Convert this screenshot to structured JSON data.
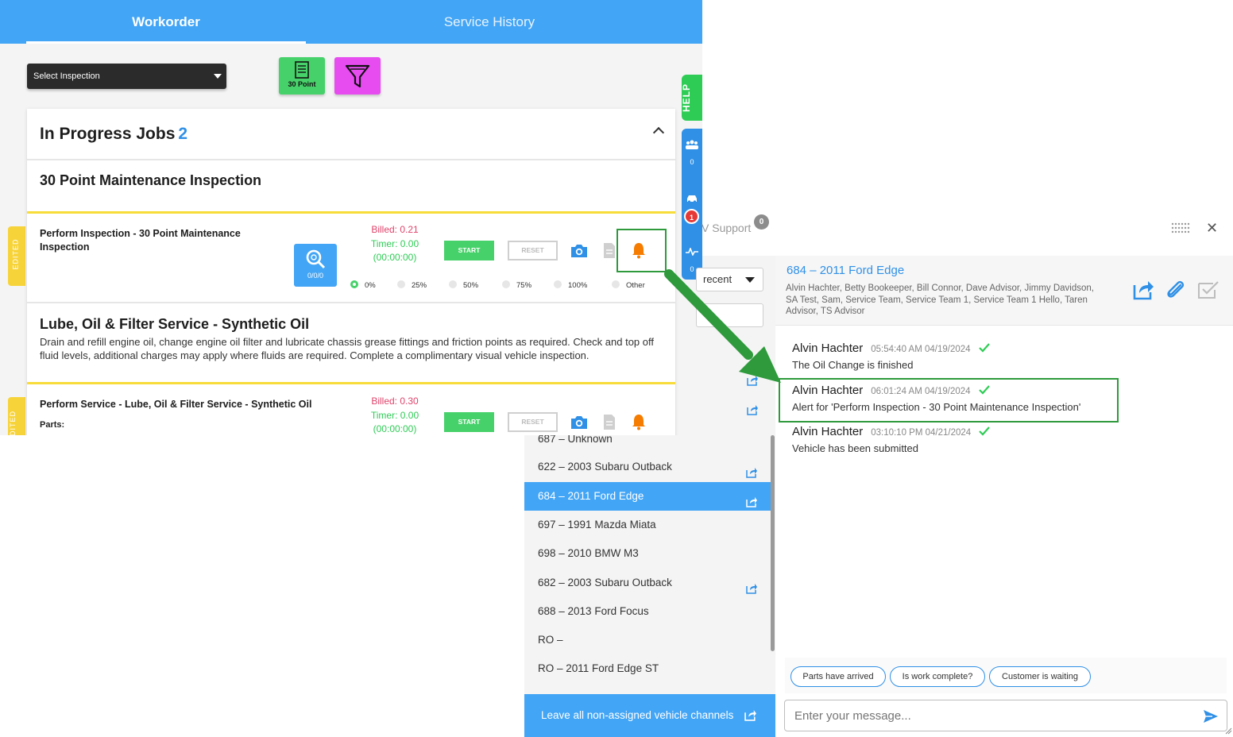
{
  "workorder": {
    "tabs": [
      {
        "label": "Workorder"
      },
      {
        "label": "Service History"
      }
    ],
    "select_inspection": "Select Inspection",
    "btn_30point": "30 Point",
    "help": "HELP",
    "rail_counts": [
      "0",
      "0"
    ],
    "rail_badge": "1",
    "in_progress": {
      "title": "In Progress Jobs",
      "count": "2"
    },
    "section1": {
      "title": "30 Point Maintenance Inspection",
      "task": {
        "title": "Perform Inspection - 30 Point Maintenance Inspection",
        "billed": "Billed: 0.21",
        "timer": "Timer: 0.00",
        "elapsed": "(00:00:00)",
        "start": "START",
        "reset": "RESET",
        "inspect_count": "0/0/0",
        "progress_options": [
          "0%",
          "25%",
          "50%",
          "75%",
          "100%",
          "Other"
        ],
        "progress_selected": "0%"
      }
    },
    "section2": {
      "title": "Lube, Oil & Filter Service - Synthetic Oil",
      "description": "Drain and refill engine oil, change engine oil filter and lubricate chassis grease fittings and friction points as required. Check and top off fluid levels, additional charges may apply where fluids are required. Complete a complimentary visual vehicle inspection.",
      "task": {
        "title": "Perform Service - Lube, Oil & Filter Service - Synthetic Oil",
        "parts": "Parts:",
        "billed": "Billed: 0.30",
        "timer": "Timer: 0.00",
        "elapsed": "(00:00:00)",
        "start": "START",
        "reset": "RESET"
      }
    },
    "edited_label": "EDITED",
    "edited_label_cut": "DITED"
  },
  "chat": {
    "channel_title": "V Support",
    "channel_badge": "0",
    "sort": "recent",
    "vehicles": [
      {
        "label": "687 – Unknown",
        "share": false,
        "active": false
      },
      {
        "label": "622 – 2003 Subaru Outback",
        "share": true,
        "active": false
      },
      {
        "label": "684 – 2011 Ford Edge",
        "share": true,
        "active": true
      },
      {
        "label": "697 – 1991 Mazda Miata",
        "share": false,
        "active": false
      },
      {
        "label": "698 – 2010 BMW M3",
        "share": false,
        "active": false
      },
      {
        "label": "682 – 2003 Subaru Outback",
        "share": true,
        "active": false
      },
      {
        "label": "688 – 2013 Ford Focus",
        "share": false,
        "active": false
      },
      {
        "label": "RO –",
        "share": false,
        "active": false
      },
      {
        "label": "RO – 2011 Ford Edge ST",
        "share": false,
        "active": false
      }
    ],
    "leave_button": "Leave all non-assigned vehicle channels",
    "active_channel": {
      "name": "684 – 2011 Ford Edge",
      "members": "Alvin Hachter, Betty Bookeeper, Bill Connor, Dave Advisor, Jimmy Davidson, SA Test, Sam, Service Team, Service Team 1, Service Team 1 Hello, Taren Advisor, TS Advisor"
    },
    "messages": [
      {
        "author": "Alvin Hachter",
        "time": "05:54:40 AM 04/19/2024",
        "text": "The Oil Change is finished"
      },
      {
        "author": "Alvin Hachter",
        "time": "06:01:24 AM 04/19/2024",
        "text": "Alert for 'Perform Inspection - 30 Point Maintenance Inspection'"
      },
      {
        "author": "Alvin Hachter",
        "time": "03:10:10 PM 04/21/2024",
        "text": "Vehicle has been submitted"
      }
    ],
    "quick_replies": [
      "Parts have arrived",
      "Is work complete?",
      "Customer is waiting"
    ],
    "input_placeholder": "Enter your message..."
  },
  "colors": {
    "accent_blue": "#42a5f5",
    "start_green": "#47d16a",
    "filter_magenta": "#e64cf0",
    "bell_orange": "#f57c00",
    "highlight_green": "#2e9a3c",
    "billed_red": "#e0436b"
  }
}
